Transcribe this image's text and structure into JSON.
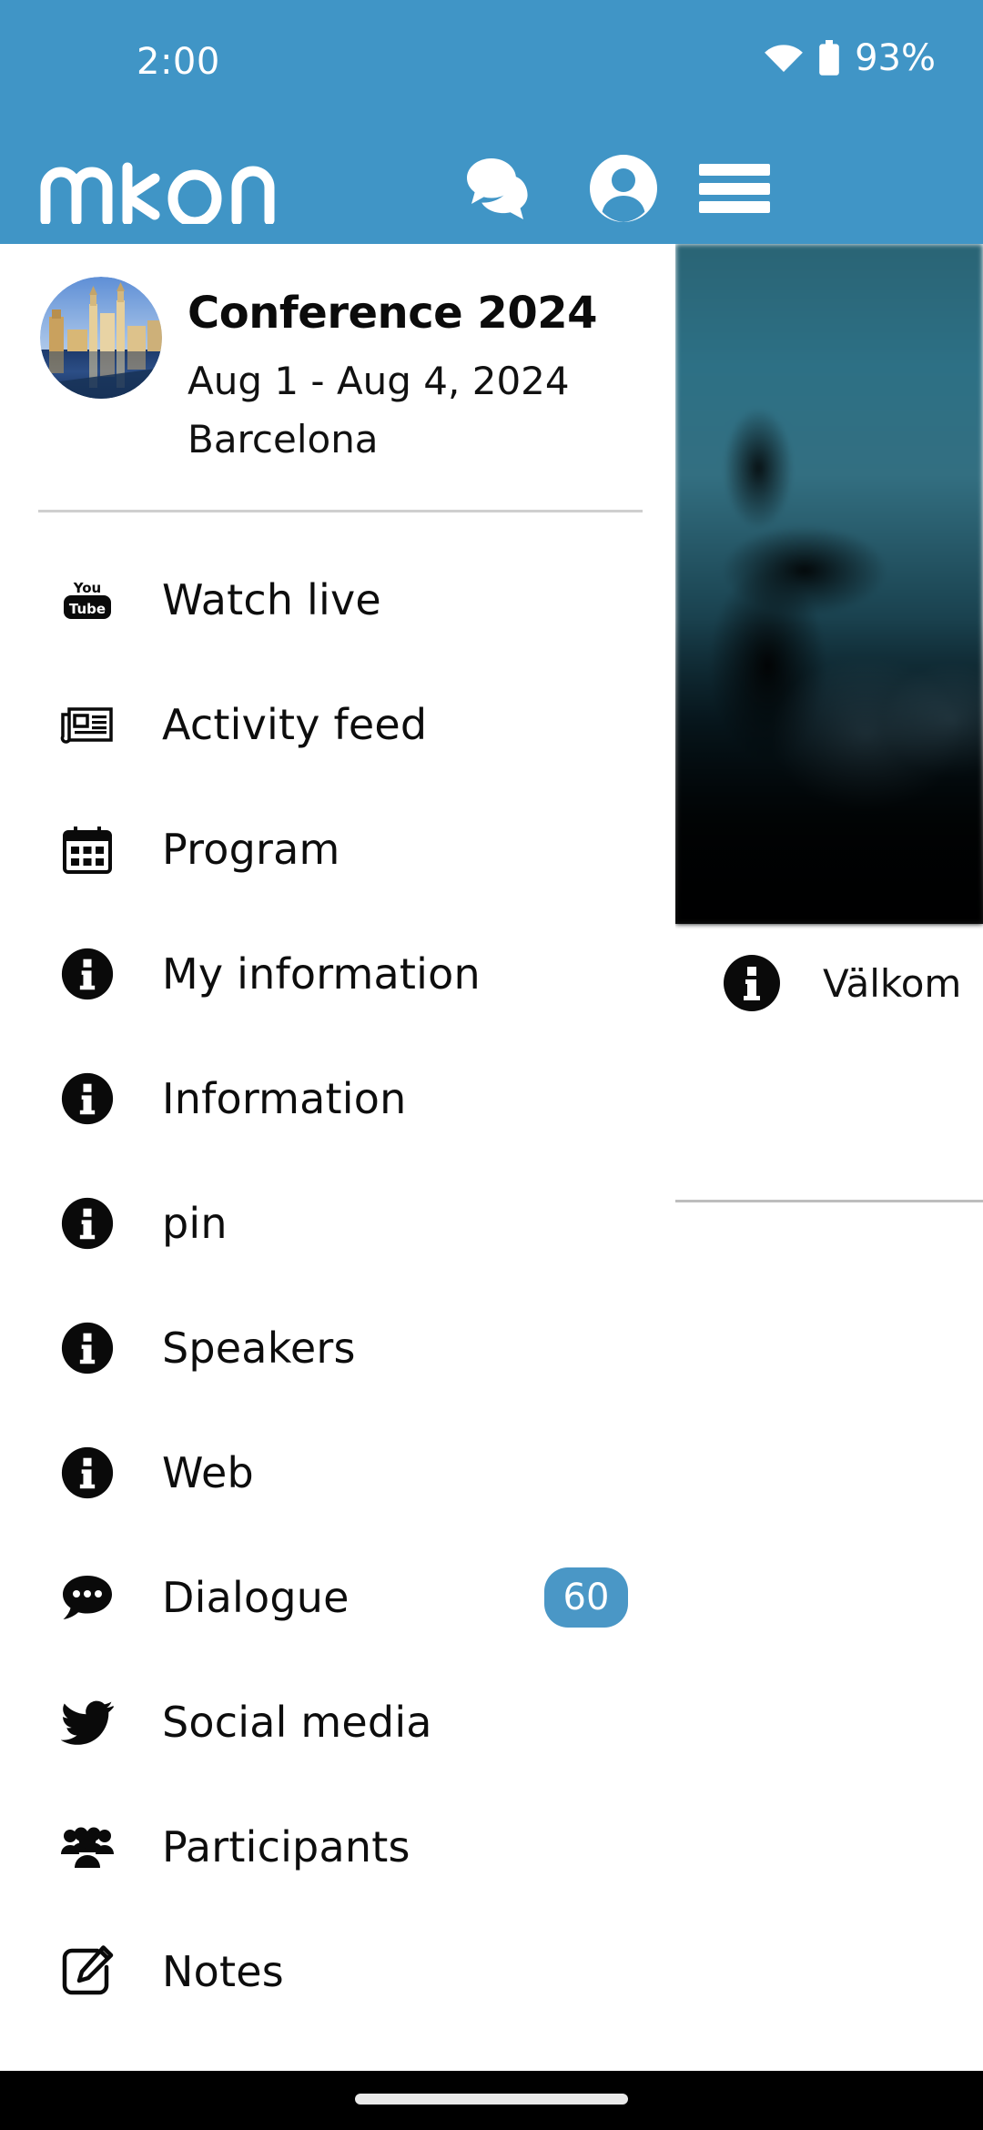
{
  "status_bar": {
    "time": "2:00",
    "battery_percent": "93%",
    "wifi_icon": "wifi-icon",
    "battery_icon": "battery-icon"
  },
  "app_bar": {
    "brand": "mkon",
    "background_color": "#4095c6",
    "actions": [
      {
        "name": "chat-icon",
        "label": "Chat"
      },
      {
        "name": "account-icon",
        "label": "Account"
      },
      {
        "name": "hamburger-icon",
        "label": "Menu"
      }
    ]
  },
  "drawer": {
    "conference": {
      "title": "Conference 2024",
      "dates": "Aug 1 - Aug 4, 2024",
      "city": "Barcelona",
      "avatar_icon": "conference-avatar"
    },
    "items": [
      {
        "label": "Watch live",
        "icon": "youtube-icon",
        "badge": ""
      },
      {
        "label": "Activity feed",
        "icon": "newspaper-icon",
        "badge": ""
      },
      {
        "label": "Program",
        "icon": "calendar-icon",
        "badge": ""
      },
      {
        "label": "My information",
        "icon": "info-icon",
        "badge": ""
      },
      {
        "label": "Information",
        "icon": "info-icon",
        "badge": ""
      },
      {
        "label": "pin",
        "icon": "info-icon",
        "badge": ""
      },
      {
        "label": "Speakers",
        "icon": "info-icon",
        "badge": ""
      },
      {
        "label": "Web",
        "icon": "info-icon",
        "badge": ""
      },
      {
        "label": "Dialogue",
        "icon": "chat-bubble-icon",
        "badge": "60"
      },
      {
        "label": "Social media",
        "icon": "twitter-icon",
        "badge": ""
      },
      {
        "label": "Participants",
        "icon": "people-icon",
        "badge": ""
      },
      {
        "label": "Notes",
        "icon": "note-edit-icon",
        "badge": ""
      }
    ],
    "badge_color": "#4a97c6"
  },
  "content": {
    "hero_image_alt": "conference-hero-image",
    "row": {
      "icon": "info-icon",
      "text": "Välkom"
    }
  },
  "nav_bar": {
    "gesture_pill": "home-gesture-pill"
  }
}
